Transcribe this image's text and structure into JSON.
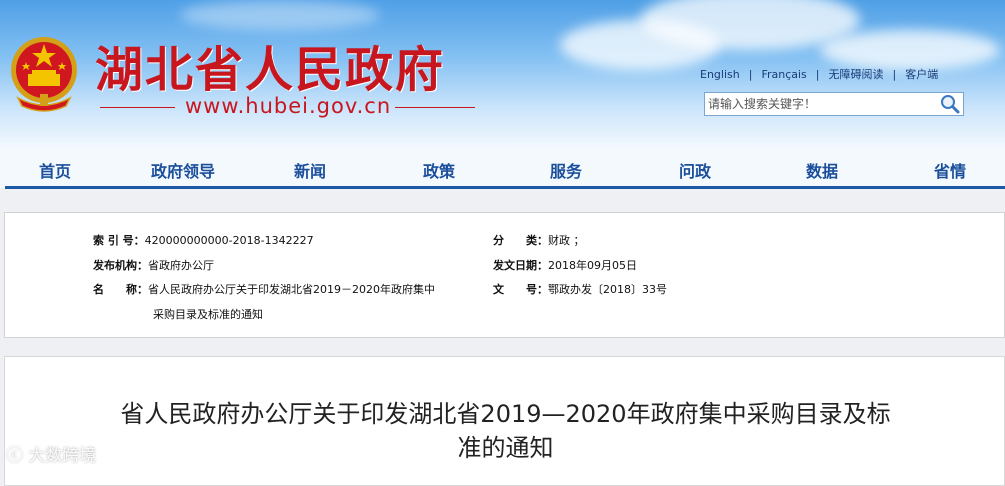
{
  "header": {
    "site_title": "湖北省人民政府",
    "site_url": "www.hubei.gov.cn",
    "links": [
      "English",
      "Français",
      "无障碍阅读",
      "客户端"
    ],
    "search_placeholder": "请输入搜索关键字！"
  },
  "nav": {
    "items": [
      "首页",
      "政府领导",
      "新闻",
      "政策",
      "服务",
      "问政",
      "数据",
      "省情"
    ]
  },
  "meta": {
    "index_label": "索 引 号：",
    "index_value": "420000000000-2018-1342227",
    "category_label": "分　　类：",
    "category_value": "财政 ；",
    "publisher_label": "发布机构：",
    "publisher_value": "省政府办公厅",
    "date_label": "发文日期：",
    "date_value": "2018年09月05日",
    "name_label": "名　　称：",
    "name_value_line1": "省人民政府办公厅关于印发湖北省2019－2020年政府集中",
    "name_value_line2": "采购目录及标准的通知",
    "docno_label": "文　　号：",
    "docno_value": "鄂政办发〔2018〕33号"
  },
  "article": {
    "title_line1": "省人民政府办公厅关于印发湖北省2019—2020年政府集中采购目录及标",
    "title_line2": "准的通知"
  },
  "watermark": "大数跨境",
  "colors": {
    "brand_red": "#c8161e",
    "nav_blue": "#1b4f9c",
    "nav_line": "#1c5aa8"
  }
}
